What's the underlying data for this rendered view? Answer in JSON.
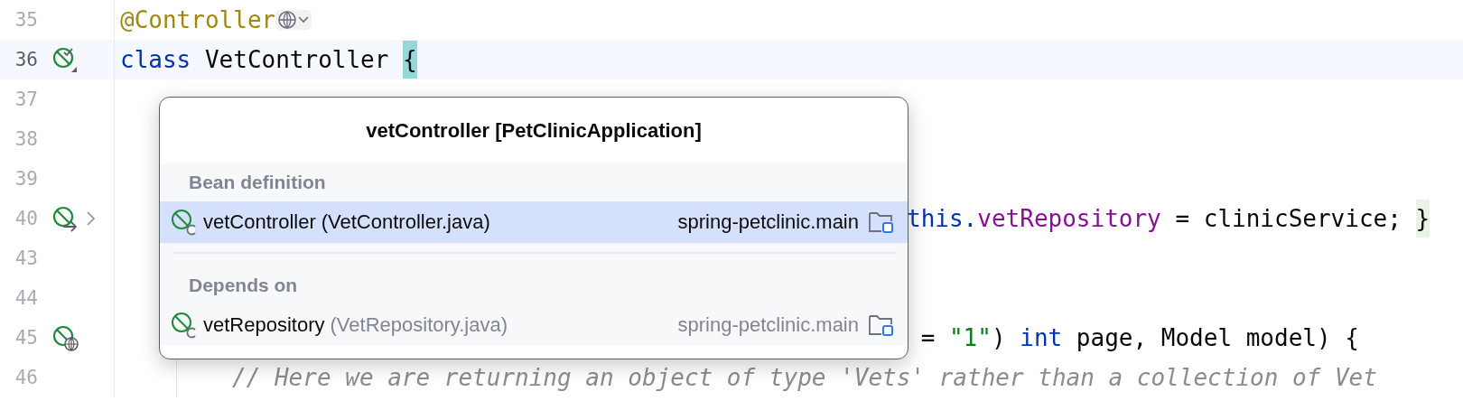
{
  "editor": {
    "lines": [
      {
        "number": "35",
        "current": false,
        "kind": "full",
        "tokens": [
          {
            "kind": "annotation",
            "text": "@Controller"
          }
        ],
        "inlay": true
      },
      {
        "number": "36",
        "current": true,
        "kind": "full",
        "marker": {
          "kind": "bean-check"
        },
        "tokens": [
          {
            "kind": "keyword",
            "text": "class"
          },
          {
            "kind": "plain",
            "text": " VetController "
          },
          {
            "kind": "match",
            "text": "{"
          }
        ]
      },
      {
        "number": "37",
        "current": false,
        "kind": "full"
      },
      {
        "number": "38",
        "current": false,
        "kind": "full"
      },
      {
        "number": "39",
        "current": false,
        "kind": "full"
      },
      {
        "number": "40",
        "current": false,
        "kind": "tail",
        "marker": {
          "kind": "bean-arrow"
        },
        "fold": {
          "expanded": false
        },
        "tokens": [
          {
            "kind": "keyword",
            "text": "this."
          },
          {
            "kind": "field",
            "text": "vetRepository"
          },
          {
            "kind": "plain",
            "text": " = clinicService; "
          },
          {
            "kind": "fold-end",
            "text": "}"
          }
        ]
      },
      {
        "number": "43",
        "current": false,
        "kind": "full"
      },
      {
        "number": "44",
        "current": false,
        "kind": "full"
      },
      {
        "number": "45",
        "current": false,
        "kind": "tail",
        "marker": {
          "kind": "bean-globe"
        },
        "tokens": [
          {
            "kind": "plain",
            "text": " = "
          },
          {
            "kind": "string",
            "text": "\"1\""
          },
          {
            "kind": "plain",
            "text": ") "
          },
          {
            "kind": "keyword",
            "text": "int"
          },
          {
            "kind": "plain",
            "text": " page, Model model) {"
          }
        ]
      },
      {
        "number": "46",
        "current": false,
        "kind": "indented",
        "tokens": [
          {
            "kind": "comment",
            "text": "// Here we are returning an object of type 'Vets' rather than a collection of Vet"
          }
        ]
      }
    ]
  },
  "popup": {
    "title": "vetController [PetClinicApplication]",
    "sections": [
      {
        "heading": "Bean definition",
        "items": [
          {
            "name": "vetController",
            "file": "(VetController.java)",
            "module": "spring-petclinic.main",
            "selected": true
          }
        ]
      },
      {
        "heading": "Depends on",
        "items": [
          {
            "name": "vetRepository",
            "file": "(VetRepository.java)",
            "module": "spring-petclinic.main",
            "selected": false
          }
        ]
      }
    ]
  }
}
